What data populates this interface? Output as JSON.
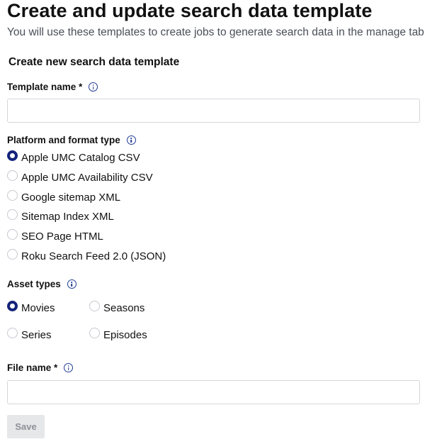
{
  "header": {
    "title": "Create and update search data template",
    "subtitle": "You will use these templates to create jobs to generate search data in the manage tab."
  },
  "form": {
    "section_title": "Create new search data template",
    "template_name": {
      "label": "Template name *",
      "value": "",
      "placeholder": ""
    },
    "platform": {
      "label": "Platform and format type",
      "selected": "Apple UMC Catalog CSV",
      "options": [
        {
          "label": "Apple UMC Catalog CSV",
          "checked": true
        },
        {
          "label": "Apple UMC Availability CSV",
          "checked": false
        },
        {
          "label": "Google sitemap XML",
          "checked": false
        },
        {
          "label": "Sitemap Index XML",
          "checked": false
        },
        {
          "label": "SEO Page HTML",
          "checked": false
        },
        {
          "label": "Roku Search Feed 2.0 (JSON)",
          "checked": false
        }
      ]
    },
    "asset_types": {
      "label": "Asset types",
      "options": [
        {
          "label": "Movies",
          "checked": true
        },
        {
          "label": "Seasons",
          "checked": false
        },
        {
          "label": "Series",
          "checked": false
        },
        {
          "label": "Episodes",
          "checked": false
        }
      ]
    },
    "file_name": {
      "label": "File name *",
      "value": "",
      "placeholder": ""
    },
    "save_label": "Save"
  },
  "icons": {
    "info": "info-circle-icon"
  },
  "colors": {
    "accent": "#14227a",
    "info_icon": "#1f3a93",
    "subtitle_text": "#4a4f57",
    "input_border": "#d3d6db",
    "button_disabled_bg": "#e6e7e9",
    "button_disabled_text": "#8d9097"
  }
}
